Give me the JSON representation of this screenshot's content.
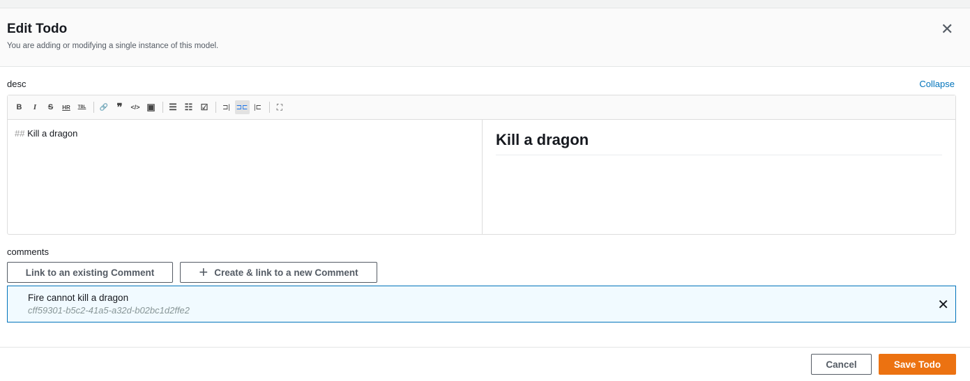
{
  "header": {
    "title": "Edit Todo",
    "subtitle": "You are adding or modifying a single instance of this model."
  },
  "desc": {
    "label": "desc",
    "collapse": "Collapse",
    "markdown_prefix": "##",
    "markdown_text": "Kill a dragon",
    "preview_heading": "Kill a dragon",
    "toolbar": {
      "bold": "B",
      "italic": "I",
      "strike": "S",
      "hr": "HR",
      "table": "TBL",
      "link": "🔗",
      "quote": "❞",
      "code": "</>",
      "image": "▣",
      "ul": "☰",
      "ol": "☷",
      "task": "☑",
      "preview": "⊐|",
      "side_by_side": "⊐⊏",
      "fullscreen_edit": "|⊏",
      "fullscreen": "⛶"
    }
  },
  "comments": {
    "label": "comments",
    "link_existing": "Link to an existing Comment",
    "create_new": "Create & link to a new Comment",
    "plus": "+",
    "items": [
      {
        "name": "Fire cannot kill a dragon",
        "id": "cff59301-b5c2-41a5-a32d-b02bc1d2ffe2"
      }
    ]
  },
  "footer": {
    "cancel": "Cancel",
    "save": "Save Todo"
  },
  "colors": {
    "accent": "#0073bb",
    "primary": "#ec7211"
  }
}
